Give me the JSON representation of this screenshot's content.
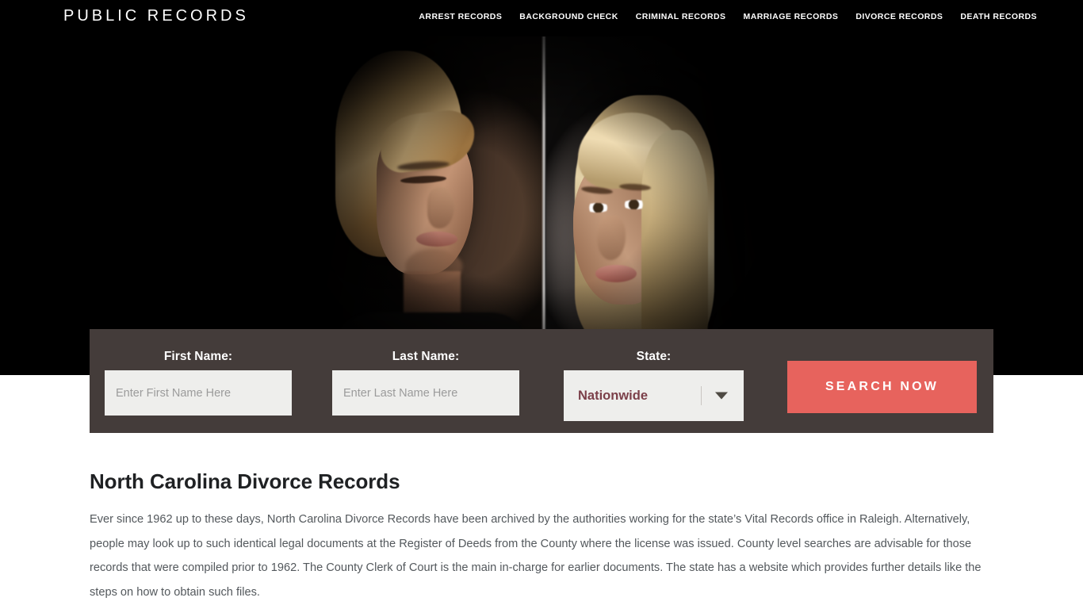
{
  "header": {
    "logo": "PUBLIC RECORDS",
    "nav": [
      {
        "label": "ARREST RECORDS"
      },
      {
        "label": "BACKGROUND CHECK"
      },
      {
        "label": "CRIMINAL RECORDS"
      },
      {
        "label": "MARRIAGE RECORDS"
      },
      {
        "label": "DIVORCE RECORDS"
      },
      {
        "label": "DEATH RECORDS"
      }
    ]
  },
  "search": {
    "first_name_label": "First Name:",
    "first_name_placeholder": "Enter First Name Here",
    "first_name_value": "",
    "last_name_label": "Last Name:",
    "last_name_placeholder": "Enter Last Name Here",
    "last_name_value": "",
    "state_label": "State:",
    "state_selected": "Nationwide",
    "submit_label": "SEARCH NOW"
  },
  "content": {
    "title": "North Carolina Divorce Records",
    "paragraph": "Ever since 1962 up to these days, North Carolina Divorce Records have been archived by the authorities working for the state’s Vital Records office in Raleigh. Alternatively, people may look up to such identical legal documents at the Register of Deeds from the County where the license was issued. County level searches are advisable for those records that were compiled prior to 1962. The County Clerk of Court is the main in-charge for earlier documents. The state has a website which provides further details like the steps on how to obtain such files."
  },
  "colors": {
    "header_bg": "#000000",
    "hero_bg": "#000000",
    "search_bar_bg": "#443c3a",
    "button_bg": "#e7635d",
    "input_bg": "#eeeeec",
    "select_text": "#7b3f49",
    "title_text": "#1f2123",
    "body_text": "#53585c"
  }
}
